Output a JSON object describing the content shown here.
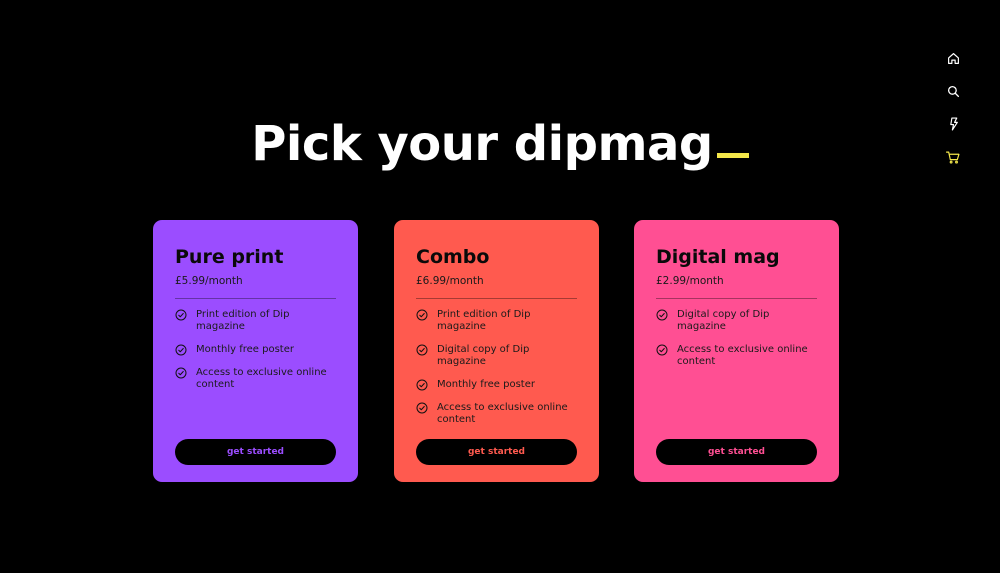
{
  "page": {
    "headline": "Pick your dipmag",
    "cursor_color": "#f4e74a",
    "background": "#000000"
  },
  "nav": {
    "items": [
      {
        "icon": "home-icon",
        "color": "#ffffff"
      },
      {
        "icon": "search-icon",
        "color": "#ffffff"
      },
      {
        "icon": "lightning-icon",
        "color": "#ffffff"
      },
      {
        "icon": "cart-icon",
        "color": "#f4e74a"
      }
    ]
  },
  "plans": [
    {
      "id": "pure-print",
      "title": "Pure print",
      "price": "£5.99/month",
      "color": "#9b4dff",
      "features": [
        "Print edition of Dip magazine",
        "Monthly free poster",
        "Access to exclusive online content"
      ],
      "cta": "get started"
    },
    {
      "id": "combo",
      "title": "Combo",
      "price": "£6.99/month",
      "color": "#ff5a4f",
      "features": [
        "Print edition of Dip magazine",
        "Digital copy of Dip magazine",
        "Monthly free poster",
        "Access to exclusive online content"
      ],
      "cta": "get started"
    },
    {
      "id": "digital-mag",
      "title": "Digital mag",
      "price": "£2.99/month",
      "color": "#ff4f93",
      "features": [
        "Digital copy of Dip magazine",
        "Access to exclusive online content"
      ],
      "cta": "get started"
    }
  ]
}
